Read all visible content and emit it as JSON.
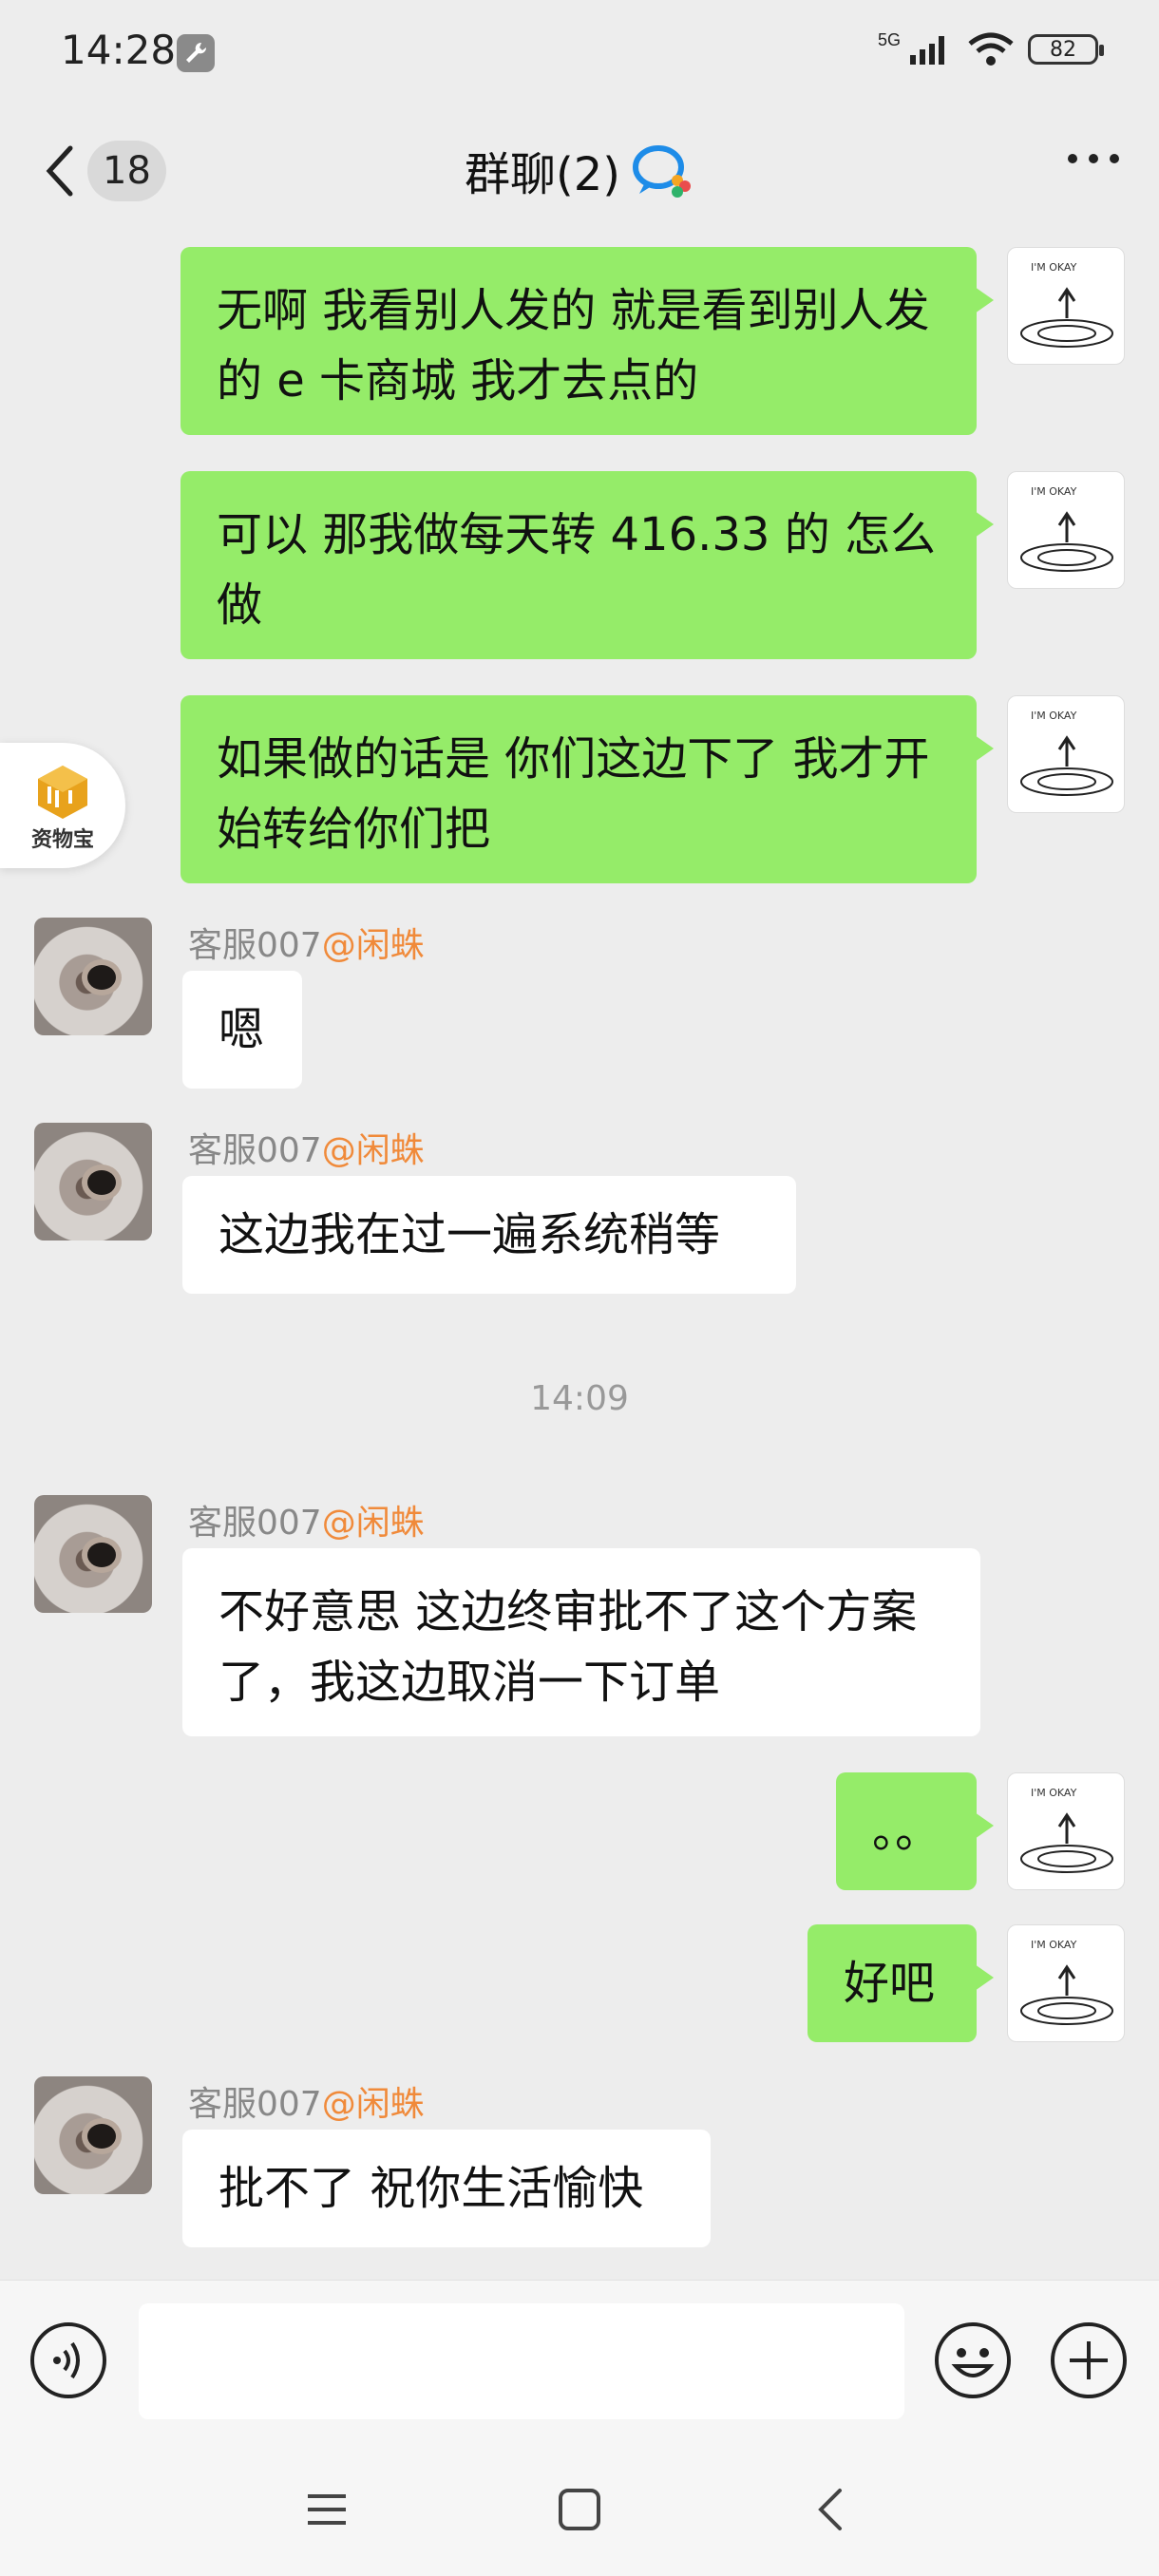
{
  "status_bar": {
    "time": "14:28",
    "network": "5G",
    "battery": "82"
  },
  "header": {
    "unread_count": "18",
    "title": "群聊(2)"
  },
  "side_widget": {
    "label": "资物宝"
  },
  "messages": [
    {
      "side": "right",
      "text": "无啊  我看别人发的  就是看到别人发的 e 卡商城  我才去点的"
    },
    {
      "side": "right",
      "text": "可以  那我做每天转 416.33 的  怎么做"
    },
    {
      "side": "right",
      "text": "如果做的话是  你们这边下了  我才开始转给你们把"
    },
    {
      "side": "left",
      "sender": "客服007",
      "mention": "@闲蛛",
      "text": "嗯"
    },
    {
      "side": "left",
      "sender": "客服007",
      "mention": "@闲蛛",
      "text": "这边我在过一遍系统稍等"
    },
    {
      "side": "divider",
      "text": "14:09"
    },
    {
      "side": "left",
      "sender": "客服007",
      "mention": "@闲蛛",
      "text": "不好意思 这边终审批不了这个方案了，我这边取消一下订单"
    },
    {
      "side": "right",
      "text": "。。"
    },
    {
      "side": "right",
      "text": "好吧"
    },
    {
      "side": "left",
      "sender": "客服007",
      "mention": "@闲蛛",
      "text": "批不了 祝你生活愉快"
    }
  ],
  "avatar_right_caption": "I'M OKAY",
  "colors": {
    "bubble_self": "#95ec69",
    "bubble_other": "#ffffff",
    "background": "#ededed",
    "mention": "#f08a3a"
  }
}
